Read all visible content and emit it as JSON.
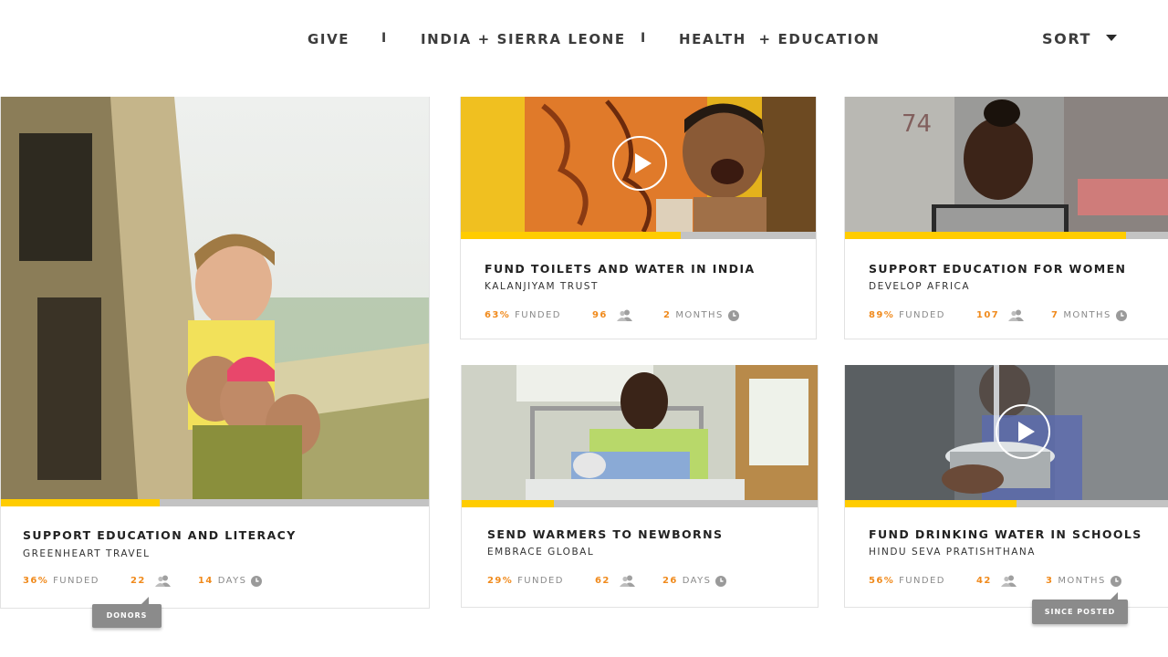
{
  "filters": {
    "give": "GIVE",
    "separator": "I",
    "location": "INDIA + SIERRA LEONE",
    "cause": "HEALTH  + EDUCATION",
    "sort": "SORT"
  },
  "colors": {
    "accent": "#f08a1c",
    "progress": "#ffcc00",
    "track": "#c3c3c3",
    "tooltip": "#8b8b8b"
  },
  "cards": [
    {
      "title": "SUPPORT EDUCATION AND LITERACY",
      "org": "GREENHEART TRAVEL",
      "funded": "36%",
      "funded_label": "FUNDED",
      "donors": "22",
      "time": "14",
      "time_unit": "DAYS",
      "progress": 0.37,
      "video": false
    },
    {
      "title": "FUND TOILETS AND WATER IN INDIA",
      "org": "KALANJIYAM TRUST",
      "funded": "63%",
      "funded_label": "FUNDED",
      "donors": "96",
      "time": "2",
      "time_unit": "MONTHS",
      "progress": 0.62,
      "video": true
    },
    {
      "title": "SUPPORT EDUCATION FOR WOMEN",
      "org": "DEVELOP AFRICA",
      "funded": "89%",
      "funded_label": "FUNDED",
      "donors": "107",
      "time": "7",
      "time_unit": "MONTHS",
      "progress": 0.87,
      "video": false
    },
    {
      "title": "SEND WARMERS TO NEWBORNS",
      "org": "EMBRACE GLOBAL",
      "funded": "29%",
      "funded_label": "FUNDED",
      "donors": "62",
      "time": "26",
      "time_unit": "DAYS",
      "progress": 0.26,
      "video": false
    },
    {
      "title": "FUND DRINKING WATER IN SCHOOLS",
      "org": "HINDU SEVA PRATISHTHANA",
      "funded": "56%",
      "funded_label": "FUNDED",
      "donors": "42",
      "time": "3",
      "time_unit": "MONTHS",
      "progress": 0.53,
      "video": true
    }
  ],
  "tooltips": {
    "donors": "DONORS",
    "since_posted": "SINCE POSTED"
  }
}
